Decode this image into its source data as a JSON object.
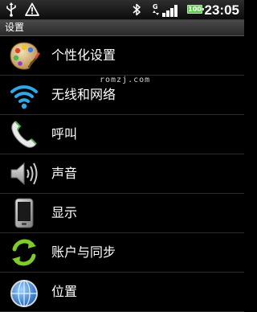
{
  "status_bar": {
    "time": "23:05",
    "battery_level": "100",
    "icons": [
      "usb-icon",
      "warning-icon",
      "bluetooth-icon",
      "gprs-signal-icon",
      "battery-icon"
    ]
  },
  "header": {
    "title": "设置"
  },
  "watermark": "romzj.com",
  "settings_items": [
    {
      "label": "个性化设置",
      "icon": "palette-icon"
    },
    {
      "label": "无线和网络",
      "icon": "wifi-icon"
    },
    {
      "label": "呼叫",
      "icon": "phone-icon"
    },
    {
      "label": "声音",
      "icon": "speaker-icon"
    },
    {
      "label": "显示",
      "icon": "display-icon"
    },
    {
      "label": "账户与同步",
      "icon": "sync-icon"
    },
    {
      "label": "位置",
      "icon": "location-globe-icon"
    }
  ],
  "colors": {
    "background": "#000000",
    "battery": "#5cc84c",
    "sync_green": "#7ecb2a",
    "wifi_blue": "#2fa8e8"
  }
}
